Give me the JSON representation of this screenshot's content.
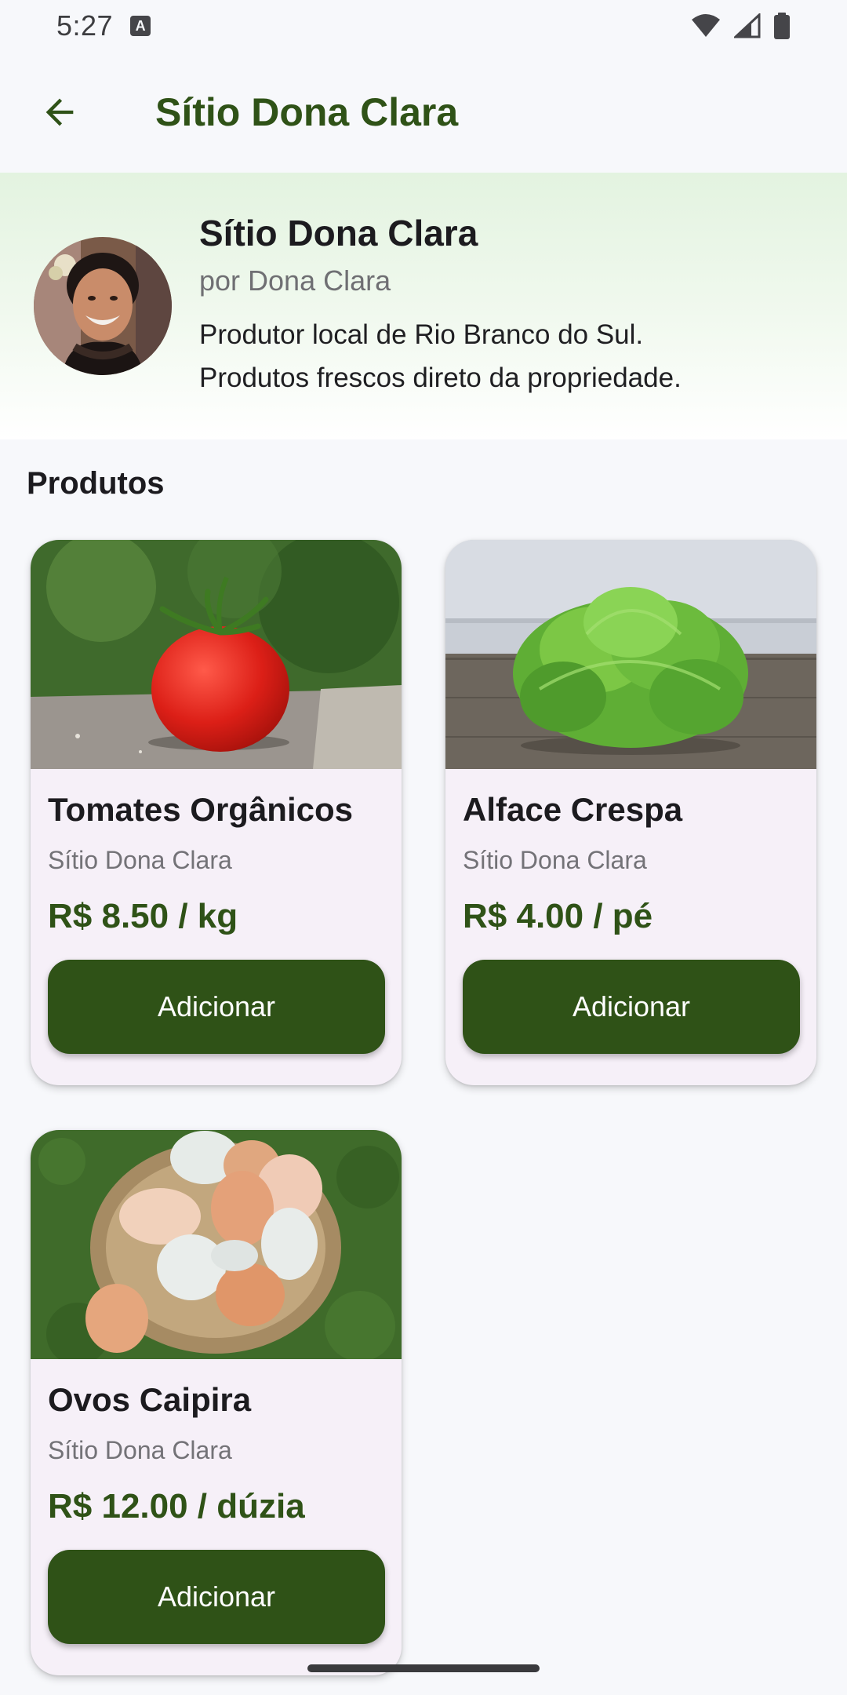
{
  "status_bar": {
    "time": "5:27",
    "notification_icon": "a-icon",
    "icons": [
      "wifi-icon",
      "signal-icon",
      "battery-icon"
    ]
  },
  "app_bar": {
    "back_icon": "arrow-left-icon",
    "title": "Sítio Dona Clara"
  },
  "producer": {
    "name": "Sítio Dona Clara",
    "owner": "por Dona Clara",
    "description_line1": "Produtor local de Rio Branco do Sul.",
    "description_line2": "Produtos frescos direto da propriedade."
  },
  "products_section": {
    "title": "Produtos",
    "items": [
      {
        "name": "Tomates Orgânicos",
        "producer": "Sítio Dona Clara",
        "price": "R$ 8.50 / kg",
        "button_label": "Adicionar",
        "image": "tomato-photo"
      },
      {
        "name": "Alface Crespa",
        "producer": "Sítio Dona Clara",
        "price": "R$ 4.00 / pé",
        "button_label": "Adicionar",
        "image": "lettuce-photo"
      },
      {
        "name": "Ovos Caipira",
        "producer": "Sítio Dona Clara",
        "price": "R$ 12.00 / dúzia",
        "button_label": "Adicionar",
        "image": "eggs-basket-photo"
      }
    ]
  },
  "colors": {
    "primary": "#2f5217",
    "background": "#f7f8fb",
    "card": "#f6f0f8",
    "header_gradient_top": "#e3f3e0"
  }
}
